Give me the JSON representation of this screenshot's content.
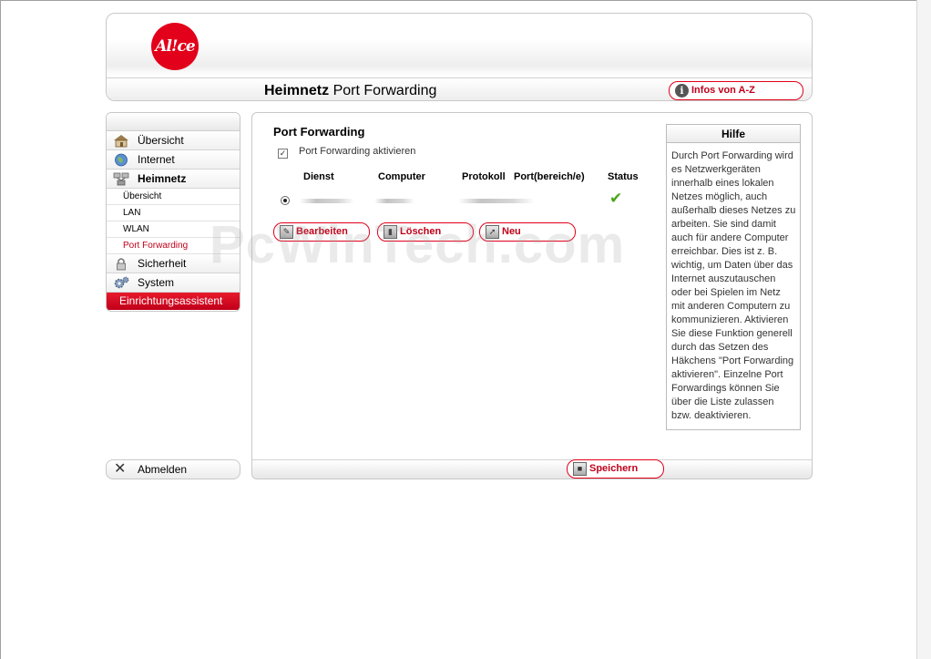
{
  "header": {
    "logo_text": "Al!ce",
    "title_bold": "Heimnetz",
    "title_rest": " Port Forwarding",
    "infos_button": "Infos von A-Z"
  },
  "sidebar": {
    "items": [
      {
        "label": "Übersicht",
        "icon": "house-icon"
      },
      {
        "label": "Internet",
        "icon": "globe-icon"
      },
      {
        "label": "Heimnetz",
        "icon": "network-icon"
      },
      {
        "label": "Übersicht"
      },
      {
        "label": "LAN"
      },
      {
        "label": "WLAN"
      },
      {
        "label": "Port Forwarding"
      },
      {
        "label": "Sicherheit",
        "icon": "lock-icon"
      },
      {
        "label": "System",
        "icon": "gears-icon"
      }
    ],
    "wizard": "Einrichtungsassistent",
    "logout": "Abmelden"
  },
  "content": {
    "section_title": "Port Forwarding",
    "checkbox_label": "Port Forwarding aktivieren",
    "checkbox_checked": true,
    "columns": [
      "Dienst",
      "Computer",
      "Protokoll",
      "Port(bereich/e)",
      "Status"
    ],
    "row_selected": true,
    "status": "active",
    "buttons": {
      "edit": "Bearbeiten",
      "delete": "Löschen",
      "new": "Neu"
    },
    "save": "Speichern"
  },
  "help": {
    "title": "Hilfe",
    "text": "Durch Port Forwarding wird es Netzwerkgeräten innerhalb eines lokalen Netzes möglich, auch außerhalb dieses Netzes zu arbeiten. Sie sind damit auch für andere Computer erreichbar. Dies ist z. B. wichtig, um Daten über das Internet auszutauschen oder bei Spielen im Netz mit anderen Computern zu kommunizieren. Aktivieren Sie diese Funktion generell durch das Setzen des Häkchens \"Port Forwarding aktivieren\". Einzelne Port Forwardings können Sie über die Liste zulassen bzw. deaktivieren."
  },
  "watermark": "PcWinTech.com",
  "colors": {
    "brand_red": "#e2001a",
    "status_green": "#4aa51c"
  }
}
